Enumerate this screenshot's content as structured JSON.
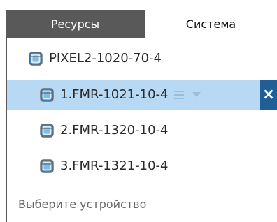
{
  "tabs": {
    "resources_label": "Ресурсы",
    "system_label": "Система",
    "active": "system"
  },
  "tree": {
    "root": {
      "label": "PIXEL2-1020-70-4",
      "icon": "device-icon"
    },
    "children": [
      {
        "label": "1.FMR-1021-10-4",
        "icon": "device-icon",
        "selected": true
      },
      {
        "label": "2.FMR-1320-10-4",
        "icon": "device-icon",
        "selected": false
      },
      {
        "label": "3.FMR-1321-10-4",
        "icon": "device-icon",
        "selected": false
      }
    ]
  },
  "selected_row_actions": {
    "menu_icon": "hamburger-icon",
    "dropdown_icon": "caret-down-icon",
    "close_icon": "close-icon",
    "close_label": "×"
  },
  "status": {
    "text": "Выберите устройство"
  },
  "colors": {
    "tab_inactive_bg": "#595959",
    "selection_bg": "#b8d9f3",
    "close_button_bg": "#1f5f95"
  }
}
